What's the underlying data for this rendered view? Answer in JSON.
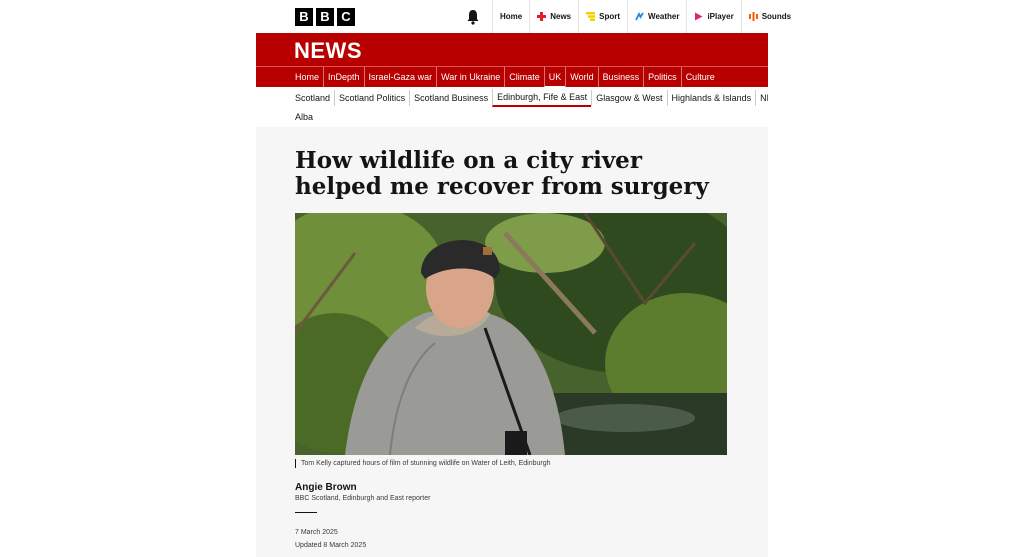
{
  "brand": {
    "letters": [
      "B",
      "B",
      "C"
    ]
  },
  "top_nav": [
    {
      "label": "Home",
      "icon": ""
    },
    {
      "label": "News",
      "icon": "news-icon",
      "color": "#e41e26"
    },
    {
      "label": "Sport",
      "icon": "sport-icon",
      "color": "#f5d000"
    },
    {
      "label": "Weather",
      "icon": "weather-icon",
      "color": "#1e88e5"
    },
    {
      "label": "iPlayer",
      "icon": "iplayer-icon",
      "color": "#e4217b"
    },
    {
      "label": "Sounds",
      "icon": "sounds-icon",
      "color": "#ff5a00"
    }
  ],
  "section": {
    "title": "NEWS"
  },
  "main_nav": [
    "Home",
    "InDepth",
    "Israel-Gaza war",
    "War in Ukraine",
    "Climate",
    "UK",
    "World",
    "Business",
    "Politics",
    "Culture"
  ],
  "main_nav_active": "UK",
  "sub_nav": [
    "Scotland",
    "Scotland Politics",
    "Scotland Business",
    "Edinburgh, Fife & East",
    "Glasgow & West",
    "Highlands & Islands",
    "NE, Orkney & Shetland"
  ],
  "sub_nav_active": "Edinburgh, Fife & East",
  "sub_nav_extra": "Alba",
  "article": {
    "headline": "How wildlife on a city river helped me recover from surgery",
    "caption": "Tom Kelly captured hours of film of stunning wildlife on Water of Leith, Edinburgh",
    "author": "Angie Brown",
    "role": "BBC Scotland, Edinburgh and East reporter",
    "date": "7 March 2025",
    "updated": "Updated 8 March 2025"
  },
  "colors": {
    "brand_red": "#b80000",
    "text": "#141414"
  }
}
